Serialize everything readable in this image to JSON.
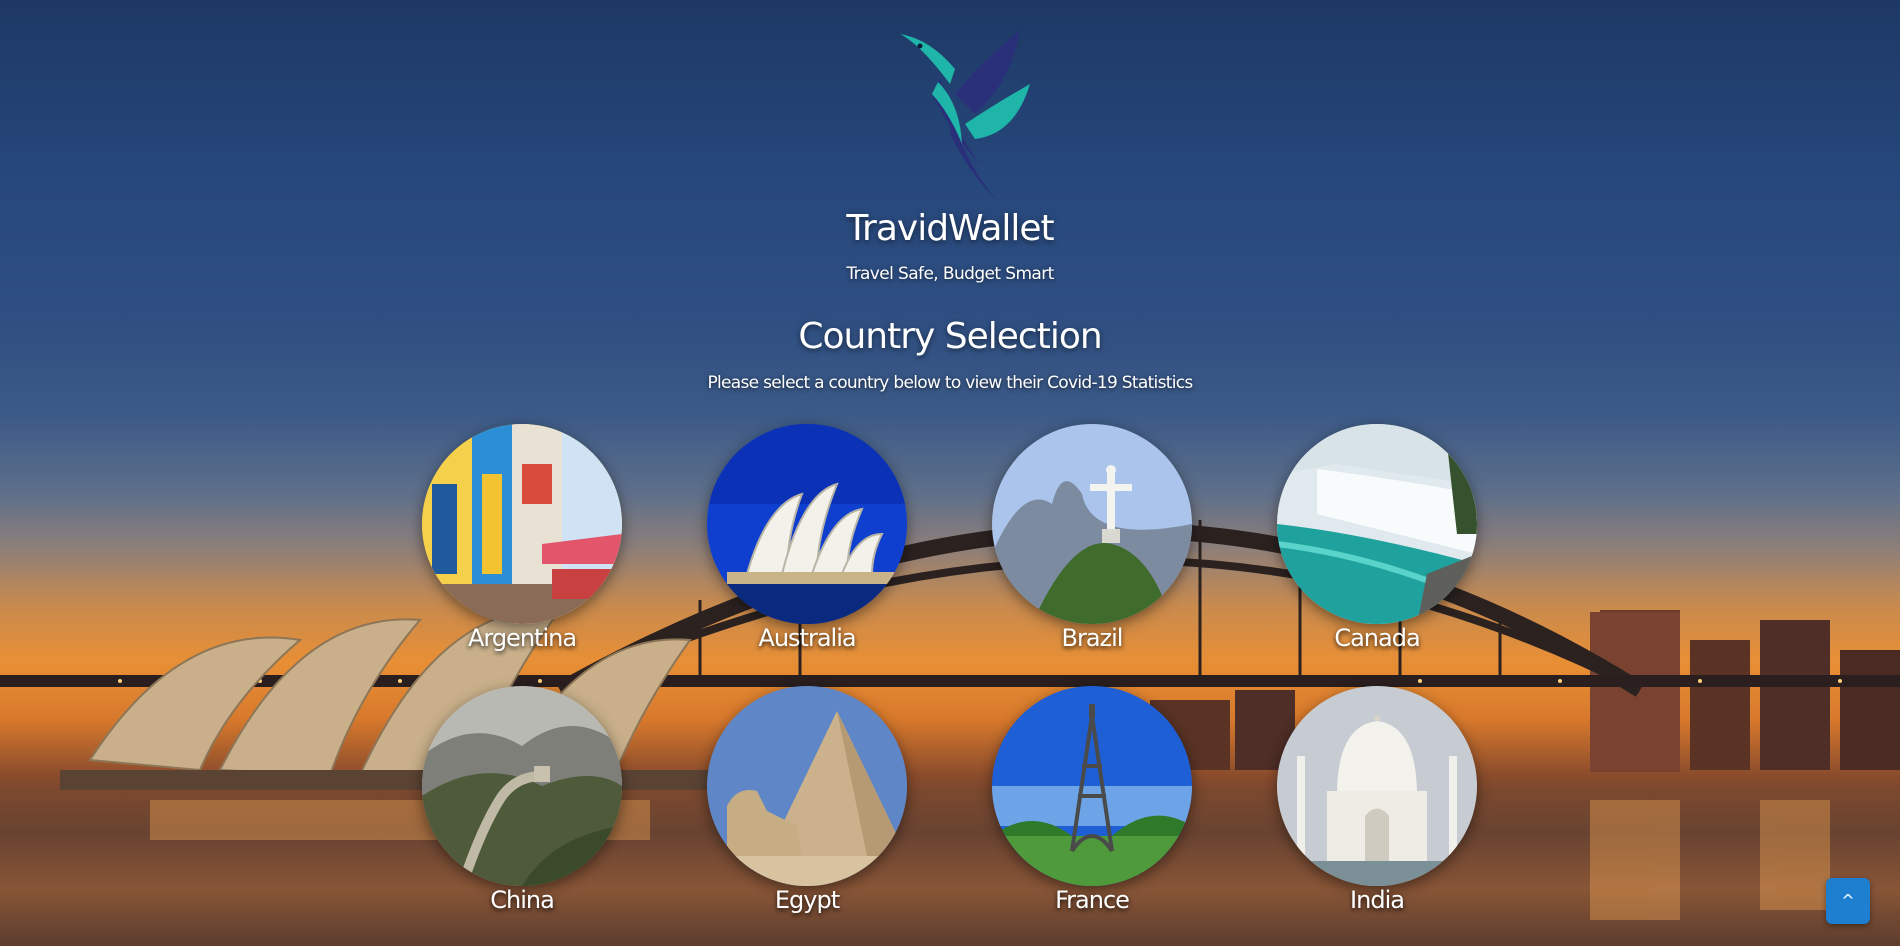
{
  "header": {
    "brand_name": "TravidWallet",
    "tagline": "Travel Safe, Budget Smart"
  },
  "main": {
    "title": "Country Selection",
    "instructions": "Please select a country below to view their Covid-19 Statistics"
  },
  "countries": [
    {
      "name": "Argentina",
      "icon": "colorful-street-photo"
    },
    {
      "name": "Australia",
      "icon": "opera-house-photo"
    },
    {
      "name": "Brazil",
      "icon": "christ-redeemer-photo"
    },
    {
      "name": "Canada",
      "icon": "niagara-falls-photo"
    },
    {
      "name": "China",
      "icon": "great-wall-photo"
    },
    {
      "name": "Egypt",
      "icon": "pyramid-sphinx-photo"
    },
    {
      "name": "France",
      "icon": "eiffel-tower-photo"
    },
    {
      "name": "India",
      "icon": "taj-mahal-photo"
    }
  ],
  "scroll_top": {
    "label": "^"
  },
  "colors": {
    "accent": "#1e7fd1",
    "logo_teal": "#1fb5a8",
    "logo_navy": "#2a2f7a"
  }
}
